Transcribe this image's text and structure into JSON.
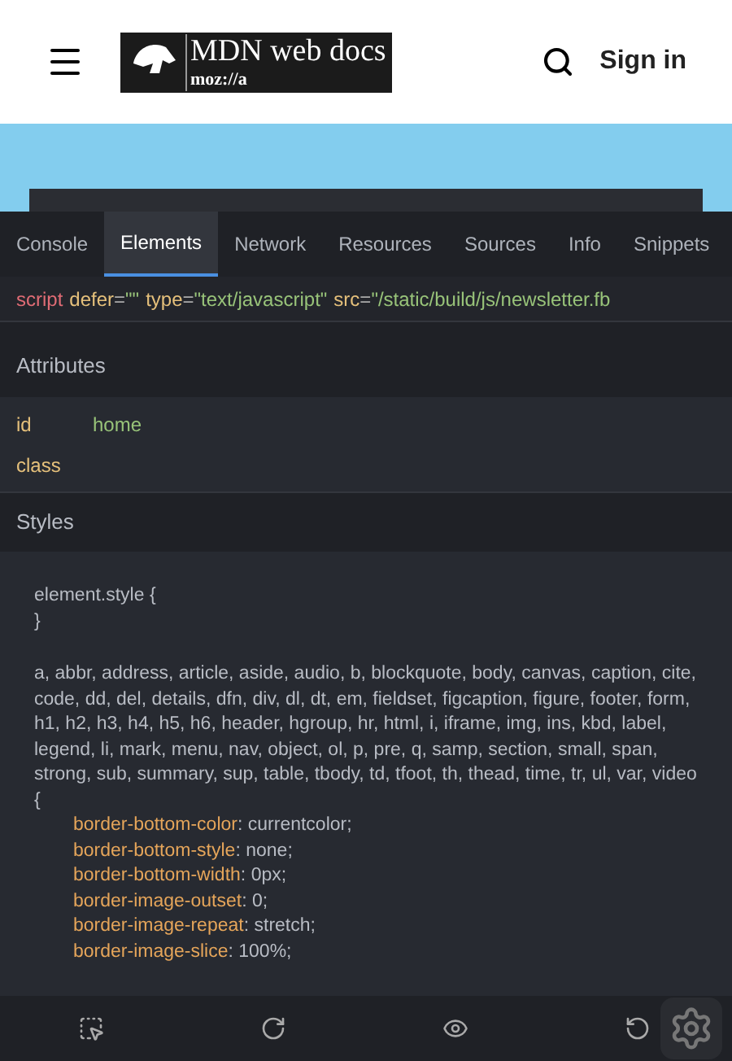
{
  "header": {
    "logo_title": "MDN web docs",
    "logo_sub": "moz://a",
    "sign_in": "Sign in"
  },
  "tabs": [
    {
      "label": "Console",
      "selected": false
    },
    {
      "label": "Elements",
      "selected": true
    },
    {
      "label": "Network",
      "selected": false
    },
    {
      "label": "Resources",
      "selected": false
    },
    {
      "label": "Sources",
      "selected": false
    },
    {
      "label": "Info",
      "selected": false
    },
    {
      "label": "Snippets",
      "selected": false
    }
  ],
  "element": {
    "tag": "script",
    "separator": "=",
    "attributes": [
      {
        "name": "defer",
        "value": "\"\""
      },
      {
        "name": "type",
        "value": "\"text/javascript\""
      },
      {
        "name": "src",
        "value": "\"/static/build/js/newsletter.fb"
      }
    ]
  },
  "attributes": {
    "title": "Attributes",
    "rows": [
      {
        "name": "id",
        "value": "home"
      },
      {
        "name": "class"
      }
    ]
  },
  "styles": {
    "title": "Styles",
    "rules": [
      {
        "selector": "element.style {",
        "close": "}"
      },
      {
        "selector": "a, abbr, address, article, aside, audio, b, blockquote, body, canvas, caption, cite, code, dd, del, details, dfn, div, dl, dt, em, fieldset, figcaption, figure, footer, form, h1, h2, h3, h4, h5, h6, header, hgroup, hr, html, i, iframe, img, ins, kbd, label, legend, li, mark, menu, nav, object, ol, p, pre, q, samp, section, small, span, strong, sub, summary, sup, table, tbody, td, tfoot, th, thead, time, tr, ul, var, video {",
        "separator": ":",
        "declarations": [
          {
            "property": "border-bottom-color",
            "value": "currentcolor;"
          },
          {
            "property": "border-bottom-style",
            "value": "none;"
          },
          {
            "property": "border-bottom-width",
            "value": "0px;"
          },
          {
            "property": "border-image-outset",
            "value": "0;"
          },
          {
            "property": "border-image-repeat",
            "value": "stretch;"
          },
          {
            "property": "border-image-slice",
            "value": "100%;"
          }
        ]
      }
    ]
  }
}
